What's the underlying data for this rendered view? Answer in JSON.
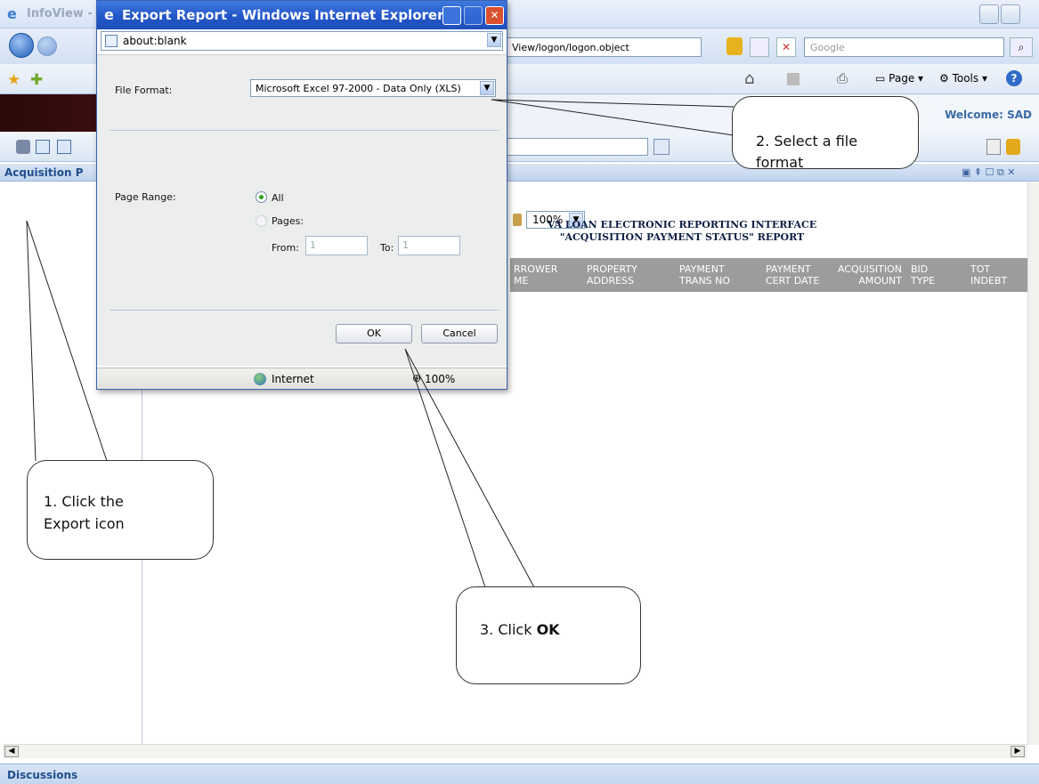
{
  "browser": {
    "title_partial": "InfoView -",
    "address_partial": "View/logon/logon.object",
    "search_placeholder": "Google",
    "page_menu": "Page",
    "tools_menu": "Tools"
  },
  "app": {
    "welcome": "Welcome: SAD",
    "panel_title": "Acquisition P",
    "footer_panel": "Discussions",
    "zoom": "100%"
  },
  "report": {
    "title_line1": "VA LOAN ELECTRONIC REPORTING INTERFACE",
    "title_line2": "\"ACQUISITION PAYMENT STATUS\" REPORT",
    "columns": [
      {
        "l1": "RROWER",
        "l2": "ME"
      },
      {
        "l1": "PROPERTY",
        "l2": "ADDRESS"
      },
      {
        "l1": "PAYMENT",
        "l2": "TRANS NO"
      },
      {
        "l1": "PAYMENT",
        "l2": "CERT DATE"
      },
      {
        "l1": "ACQUISITION",
        "l2": "AMOUNT"
      },
      {
        "l1": "BID",
        "l2": "TYPE"
      },
      {
        "l1": "TOT",
        "l2": "INDEBT"
      }
    ]
  },
  "dialog": {
    "title": "Export Report - Windows Internet Explorer",
    "address": "about:blank",
    "file_format_label": "File Format:",
    "file_format_value": "Microsoft Excel 97-2000 - Data Only (XLS)",
    "page_range_label": "Page Range:",
    "option_all": "All",
    "option_pages": "Pages:",
    "from_label": "From:",
    "from_value": "1",
    "to_label": "To:",
    "to_value": "1",
    "ok_label": "OK",
    "cancel_label": "Cancel",
    "status_zone": "Internet",
    "status_zoom": "100%"
  },
  "callouts": {
    "step1_line1": "1. Click the",
    "step1_line2": "Export icon",
    "step2_line1": "2. Select a file",
    "step2_line2": "format",
    "step3_prefix": "3. Click ",
    "step3_bold": "OK"
  }
}
